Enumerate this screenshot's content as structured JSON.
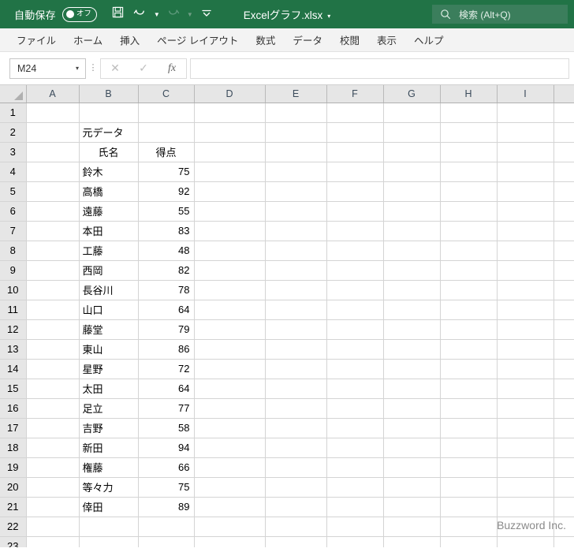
{
  "titlebar": {
    "autosave_label": "自動保存",
    "autosave_state": "オフ",
    "document_title": "Excelグラフ.xlsx",
    "title_caret": "▾",
    "quick_access": [
      {
        "name": "save-icon",
        "label": "保存"
      },
      {
        "name": "undo-icon",
        "label": "元に戻す"
      },
      {
        "name": "redo-icon",
        "label": "やり直し"
      },
      {
        "name": "customize-toolbar-icon",
        "label": "クイック アクセス ツール バーのユーザー設定"
      }
    ],
    "search_placeholder": "検索 (Alt+Q)",
    "colors": {
      "titlebar_green": "#217346",
      "search_green": "#3b7e5c"
    }
  },
  "ribbon": {
    "tabs": [
      {
        "label": "ファイル"
      },
      {
        "label": "ホーム"
      },
      {
        "label": "挿入"
      },
      {
        "label": "ページ レイアウト"
      },
      {
        "label": "数式"
      },
      {
        "label": "データ"
      },
      {
        "label": "校閲"
      },
      {
        "label": "表示"
      },
      {
        "label": "ヘルプ"
      }
    ]
  },
  "formula_bar": {
    "name_box_value": "M24",
    "name_box_caret": "▾",
    "cancel_icon": "✕",
    "enter_icon": "✓",
    "fx_icon": "fx",
    "formula_value": ""
  },
  "grid": {
    "columns": [
      "A",
      "B",
      "C",
      "D",
      "E",
      "F",
      "G",
      "H",
      "I"
    ],
    "rows": [
      1,
      2,
      3,
      4,
      5,
      6,
      7,
      8,
      9,
      10,
      11,
      12,
      13,
      14,
      15,
      16,
      17,
      18,
      19,
      20,
      21,
      22,
      23
    ],
    "cells": {
      "B2": "元データ",
      "B3": "氏名",
      "C3": "得点"
    },
    "table": {
      "header": [
        "氏名",
        "得点"
      ],
      "rows": [
        {
          "row": 4,
          "name": "鈴木",
          "score": "75"
        },
        {
          "row": 5,
          "name": "高橋",
          "score": "92"
        },
        {
          "row": 6,
          "name": "遠藤",
          "score": "55"
        },
        {
          "row": 7,
          "name": "本田",
          "score": "83"
        },
        {
          "row": 8,
          "name": "工藤",
          "score": "48"
        },
        {
          "row": 9,
          "name": "西岡",
          "score": "82"
        },
        {
          "row": 10,
          "name": "長谷川",
          "score": "78"
        },
        {
          "row": 11,
          "name": "山口",
          "score": "64"
        },
        {
          "row": 12,
          "name": "藤堂",
          "score": "79"
        },
        {
          "row": 13,
          "name": "東山",
          "score": "86"
        },
        {
          "row": 14,
          "name": "星野",
          "score": "72"
        },
        {
          "row": 15,
          "name": "太田",
          "score": "64"
        },
        {
          "row": 16,
          "name": "足立",
          "score": "77"
        },
        {
          "row": 17,
          "name": "吉野",
          "score": "58"
        },
        {
          "row": 18,
          "name": "新田",
          "score": "94"
        },
        {
          "row": 19,
          "name": "権藤",
          "score": "66"
        },
        {
          "row": 20,
          "name": "等々力",
          "score": "75"
        },
        {
          "row": 21,
          "name": "倖田",
          "score": "89"
        }
      ]
    }
  },
  "watermark": {
    "text": "Buzzword Inc."
  }
}
